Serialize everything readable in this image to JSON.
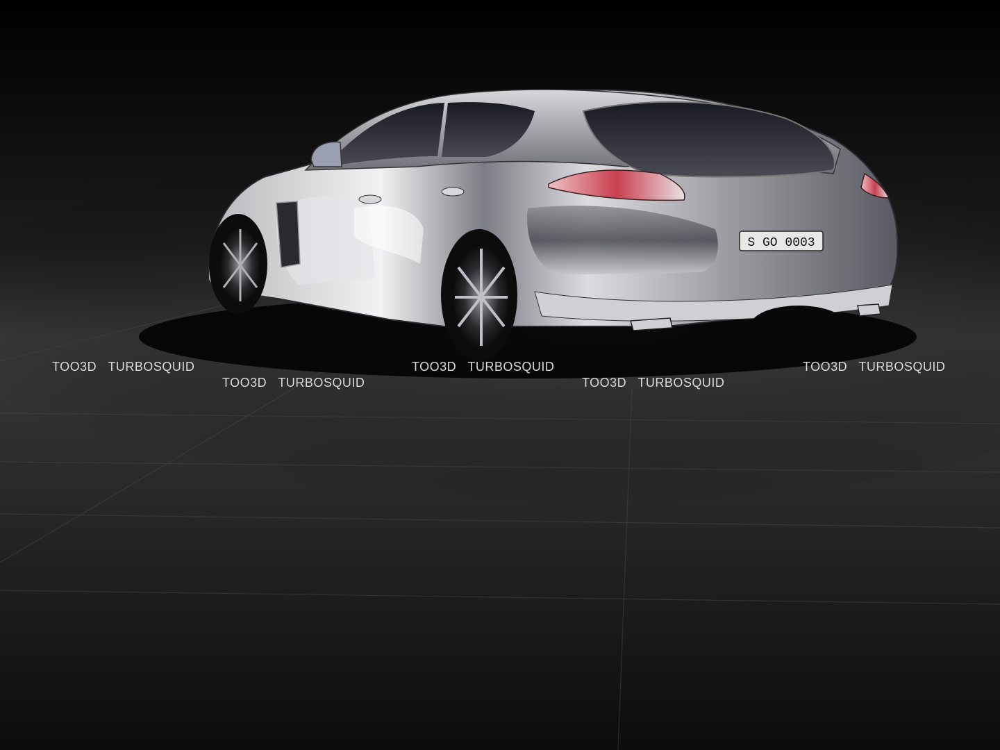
{
  "scene": {
    "subject": "chrome-sports-sedan",
    "license_plate": "S GO 0003",
    "colors": {
      "background": "#000000",
      "floor": "#2b2b2b",
      "chrome_light": "#e8e8ec",
      "chrome_dark": "#3a3a40",
      "taillight": "#c8404a"
    }
  },
  "watermarks": [
    {
      "text": "TOO3D   TURBOSQUID"
    },
    {
      "text": "TOO3D   TURBOSQUID"
    },
    {
      "text": "TOO3D   TURBOSQUID"
    },
    {
      "text": "TOO3D   TURBOSQUID"
    },
    {
      "text": "TOO3D   TURBOSQUID"
    }
  ]
}
